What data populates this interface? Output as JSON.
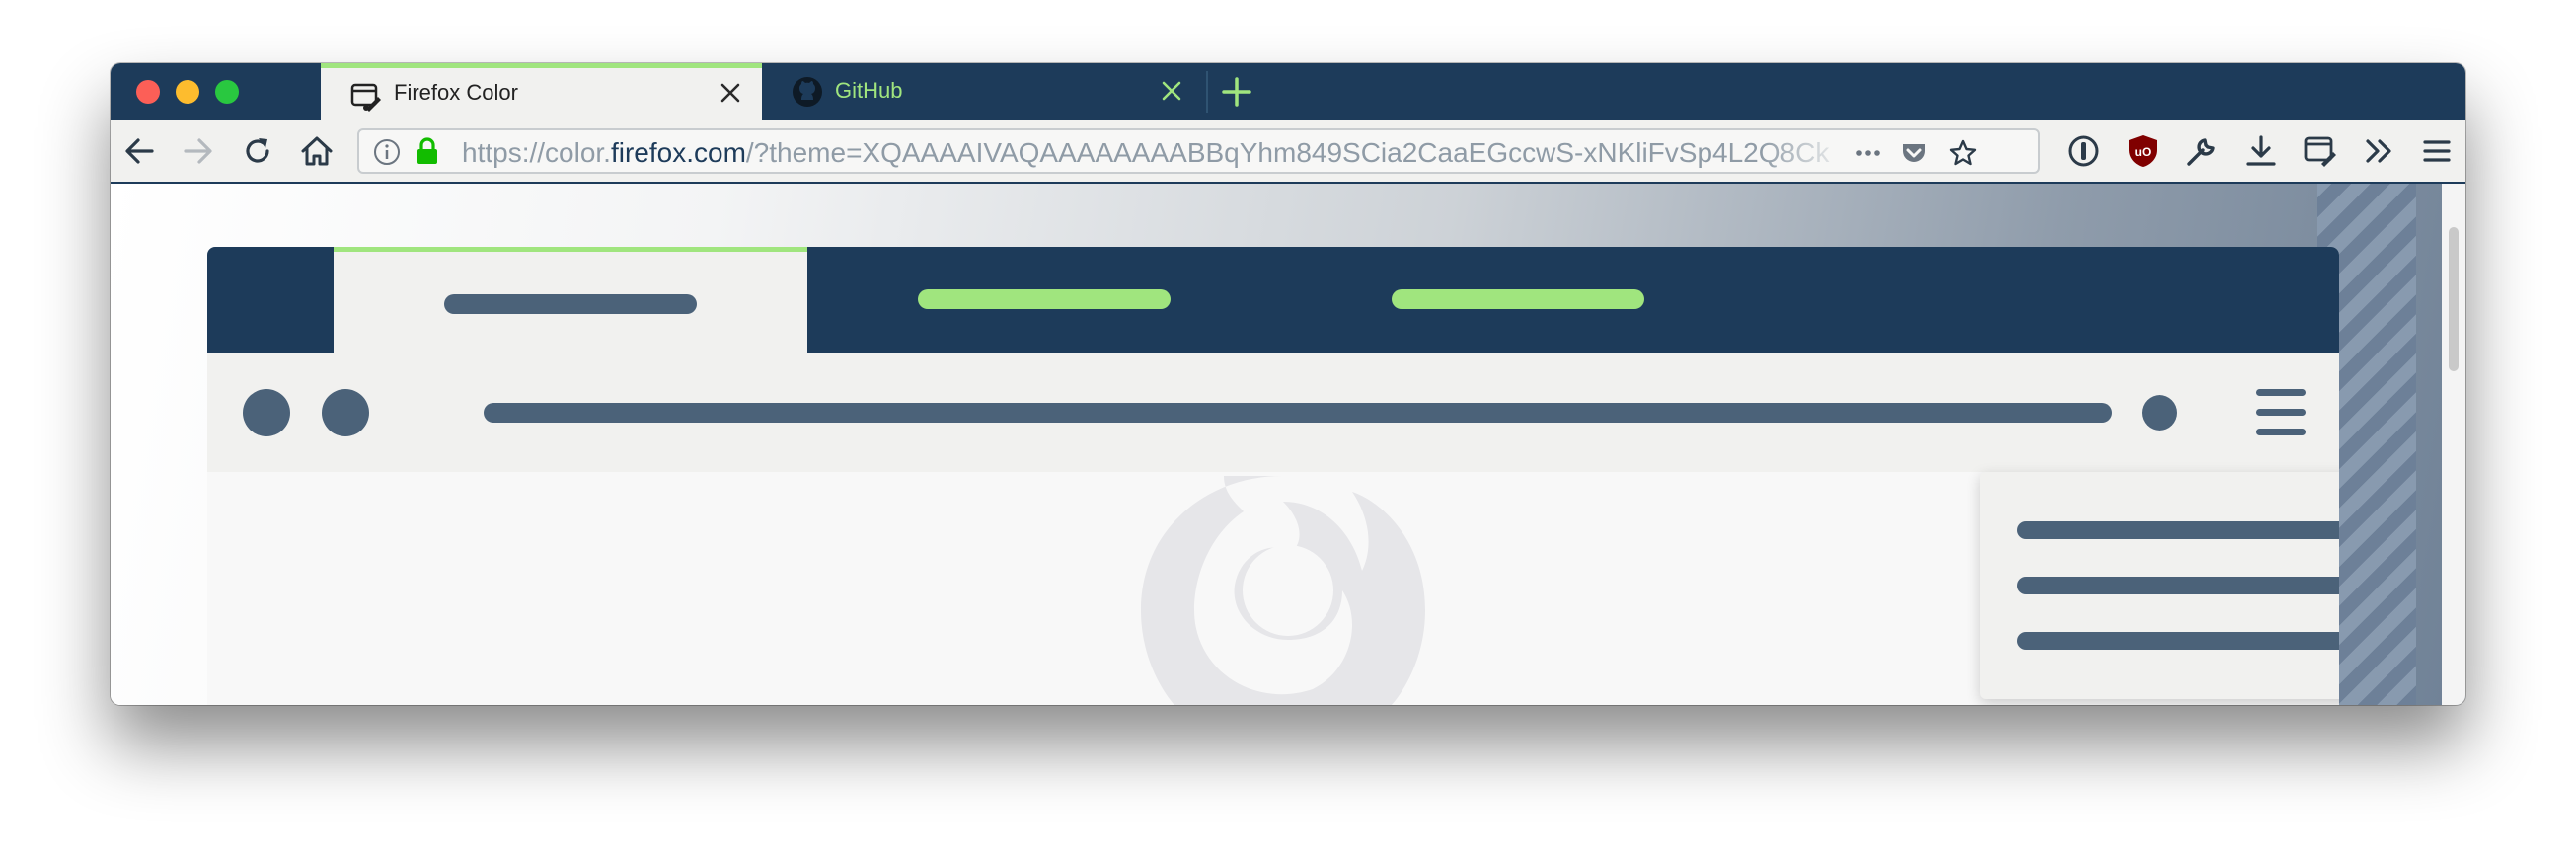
{
  "colors": {
    "frame": "#1d3b5a",
    "accent": "#a0e57e",
    "toolbar": "#f1f1ef",
    "placeholder_bar": "#4b6279"
  },
  "tabs": [
    {
      "title": "Firefox Color",
      "icon": "firefox-color-icon",
      "active": true
    },
    {
      "title": "GitHub",
      "icon": "github-icon",
      "active": false
    }
  ],
  "toolbar": {
    "url_prefix": "https://color.",
    "url_host": "firefox.com",
    "url_rest": "/?theme=XQAAAAIVAQAAAAAAAABBqYhm849SCia2CaaEGccwS-xNKliFvSp4L2Q8Ck",
    "icons": [
      "back-icon",
      "forward-icon",
      "reload-icon",
      "home-icon",
      "info-icon",
      "lock-icon",
      "page-actions-icon",
      "pocket-icon",
      "bookmark-star-icon",
      "1password-icon",
      "ublock-icon",
      "wrench-icon",
      "download-icon",
      "firefox-color-icon",
      "overflow-icon",
      "hamburger-menu-icon"
    ]
  }
}
